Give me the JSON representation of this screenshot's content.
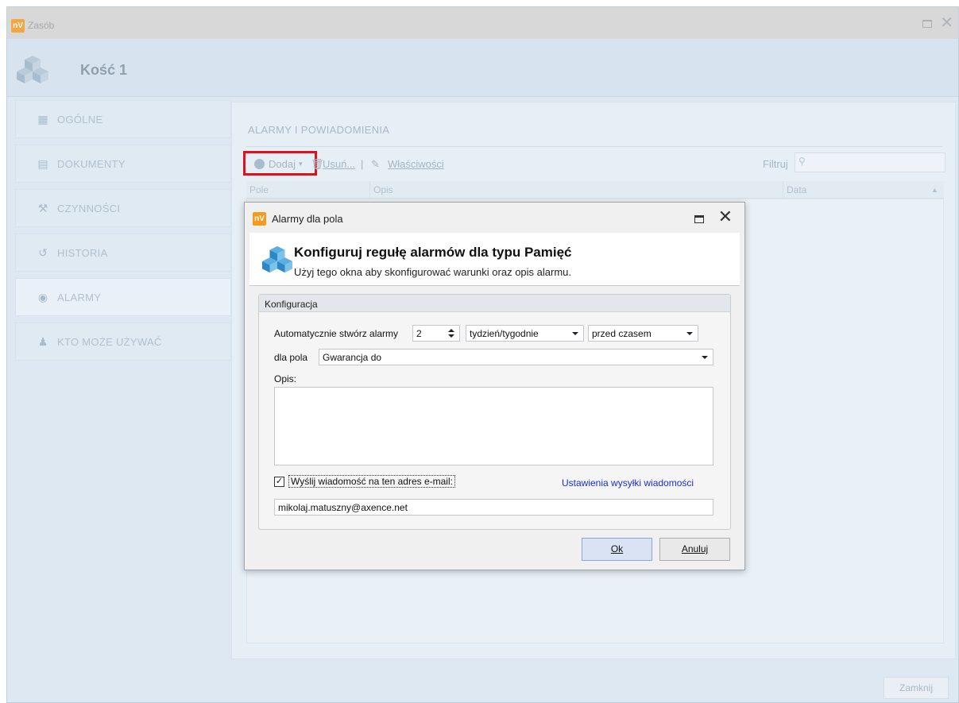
{
  "window": {
    "title": "Zasób",
    "logo": "nV"
  },
  "resource": {
    "title": "Kość 1",
    "icon": "cubes-icon"
  },
  "sidebar": {
    "items": [
      {
        "label": "OGÓLNE",
        "icon": "general-icon"
      },
      {
        "label": "DOKUMENTY",
        "icon": "document-icon"
      },
      {
        "label": "CZYNNOŚCI",
        "icon": "wrench-icon"
      },
      {
        "label": "HISTORIA",
        "icon": "history-icon"
      },
      {
        "label": "ALARMY",
        "icon": "alarm-icon",
        "active": true
      },
      {
        "label": "KTO MOŻE UŻYWAĆ",
        "icon": "user-icon"
      }
    ]
  },
  "section": {
    "title": "ALARMY I POWIADOMIENIA"
  },
  "toolbar": {
    "add_label": "Dodaj",
    "delete_label": "Usuń...",
    "separator": "|",
    "properties_label": "Właściwości",
    "filter_label": "Filtruj"
  },
  "grid": {
    "columns": [
      "Pole",
      "Opis",
      "Data"
    ]
  },
  "footer": {
    "close_label": "Zamknij"
  },
  "dialog": {
    "logo": "nV",
    "title": "Alarmy dla pola",
    "heading": "Konfiguruj regułę alarmów dla typu Pamięć",
    "subtitle": "Użyj tego okna aby skonfigurować warunki oraz opis alarmu.",
    "group_title": "Konfiguracja",
    "auto_create_label": "Automatycznie stwórz alarmy",
    "count_value": "2",
    "unit_value": "tydzień/tygodnie",
    "when_value": "przed czasem",
    "field_label": "dla pola",
    "field_value": "Gwarancja do",
    "description_label": "Opis:",
    "description_value": "",
    "email_checkbox_checked": true,
    "email_checkbox_label": "Wyślij wiadomość na ten adres e-mail:",
    "send_settings_link": "Ustawienia wysyłki wiadomości",
    "email_value": "mikolaj.matuszny@axence.net",
    "ok_label": "Ok",
    "cancel_label": "Anuluj"
  },
  "colors": {
    "highlight": "#e0101c",
    "link": "#1a2ed0",
    "logo": "#f39a1f"
  }
}
